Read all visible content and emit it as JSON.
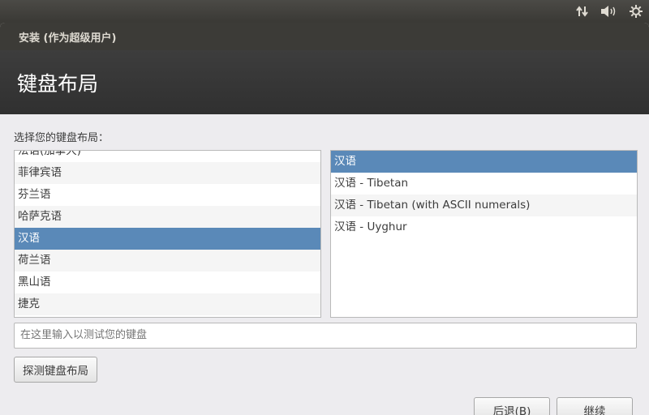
{
  "system_tray": {
    "icons": [
      "network-transfer-icon",
      "volume-icon",
      "settings-gear-icon"
    ]
  },
  "window": {
    "title": "安装 (作为超级用户)",
    "header": "键盘布局"
  },
  "prompt": "选择您的键盘布局：",
  "layout_list": {
    "items": [
      {
        "label": "法语(加拿大)",
        "selected": false
      },
      {
        "label": "菲律宾语",
        "selected": false
      },
      {
        "label": "芬兰语",
        "selected": false
      },
      {
        "label": "哈萨克语",
        "selected": false
      },
      {
        "label": "汉语",
        "selected": true
      },
      {
        "label": "荷兰语",
        "selected": false
      },
      {
        "label": "黑山语",
        "selected": false
      },
      {
        "label": "捷克",
        "selected": false
      }
    ]
  },
  "variant_list": {
    "items": [
      {
        "label": "汉语",
        "selected": true
      },
      {
        "label": "汉语 - Tibetan",
        "selected": false
      },
      {
        "label": "汉语 - Tibetan (with ASCII numerals)",
        "selected": false
      },
      {
        "label": "汉语 - Uyghur",
        "selected": false
      }
    ]
  },
  "test_input": {
    "placeholder": "在这里输入以测试您的键盘",
    "value": ""
  },
  "buttons": {
    "detect": "探测键盘布局",
    "back": "后退(B)",
    "next": "继续"
  },
  "colors": {
    "selection": "#5a89b8",
    "header_bg": "#353535",
    "content_bg": "#edecef"
  }
}
